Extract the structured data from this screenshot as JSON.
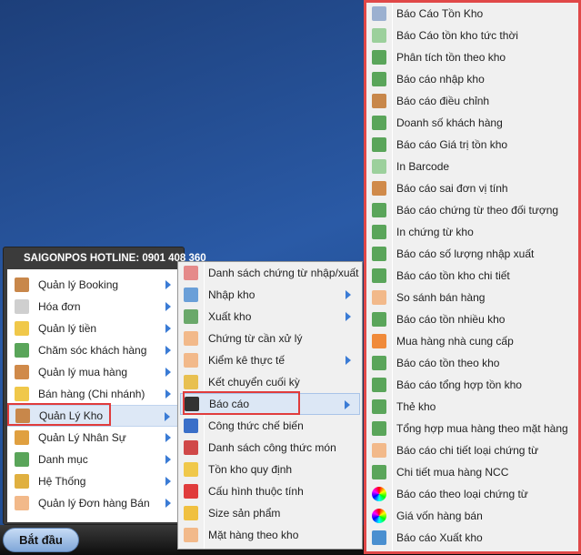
{
  "colors": {
    "highlight_box": "#e03c3c",
    "accent_arrow": "#3a7bd5"
  },
  "start_menu": {
    "hotline": "SAIGONPOS HOTLINE: 0901 408 360",
    "items": [
      {
        "label": "Quản lý Booking",
        "icon": "house-icon",
        "color": "#c8874a"
      },
      {
        "label": "Hóa đơn",
        "icon": "box-icon",
        "color": "#cfcfcf"
      },
      {
        "label": "Quản lý tiền",
        "icon": "folder-icon",
        "color": "#f0c84a"
      },
      {
        "label": "Chăm sóc khách hàng",
        "icon": "network-icon",
        "color": "#5aa55a"
      },
      {
        "label": "Quản lý mua hàng",
        "icon": "user-house-icon",
        "color": "#d08a4a"
      },
      {
        "label": "Bán hàng (Chi nhánh)",
        "icon": "folder-icon",
        "color": "#f0c84a"
      },
      {
        "label": "Quản Lý Kho",
        "icon": "house-icon",
        "color": "#c8874a",
        "selected": true
      },
      {
        "label": "Quản Lý Nhân Sự",
        "icon": "user-icon",
        "color": "#e0a040"
      },
      {
        "label": "Danh mục",
        "icon": "network-icon",
        "color": "#5aa55a"
      },
      {
        "label": "Hệ Thống",
        "icon": "system-icon",
        "color": "#e0b040"
      },
      {
        "label": "Quản lý Đơn hàng Bán",
        "icon": "tag-icon",
        "color": "#f2b98a"
      }
    ]
  },
  "kho_menu": {
    "items": [
      {
        "label": "Danh sách chứng từ nhập/xuất",
        "icon": "table-icon",
        "color": "#e58a8a",
        "arrow": false
      },
      {
        "label": "Nhập kho",
        "icon": "window-in-icon",
        "color": "#6a9fd8",
        "arrow": true
      },
      {
        "label": "Xuất kho",
        "icon": "window-out-icon",
        "color": "#6aa86a",
        "arrow": true
      },
      {
        "label": "Chứng từ cần xử lý",
        "icon": "tag-icon",
        "color": "#f2b98a",
        "arrow": false
      },
      {
        "label": "Kiểm kê thực tế",
        "icon": "tag-icon",
        "color": "#f2b98a",
        "arrow": true
      },
      {
        "label": "Kết chuyển cuối kỳ",
        "icon": "transfer-icon",
        "color": "#e8c050",
        "arrow": false
      },
      {
        "label": "Báo cáo",
        "icon": "magic-wand-icon",
        "color": "#333",
        "arrow": true,
        "selected": true
      },
      {
        "label": "Công thức chế biến",
        "icon": "ab-icon",
        "color": "#3a6fc8",
        "arrow": false
      },
      {
        "label": "Danh sách công thức món",
        "icon": "cubes-icon",
        "color": "#d04848",
        "arrow": false
      },
      {
        "label": "Tồn kho quy định",
        "icon": "folder-icon",
        "color": "#f0c84a",
        "arrow": false
      },
      {
        "label": "Cấu hình thuộc tính",
        "icon": "gem-icon",
        "color": "#e03c3c",
        "arrow": false
      },
      {
        "label": "Size sản phẩm",
        "icon": "cake-icon",
        "color": "#f0c040",
        "arrow": false
      },
      {
        "label": "Mặt hàng theo kho",
        "icon": "tag-icon",
        "color": "#f2b98a",
        "arrow": false
      }
    ]
  },
  "bao_cao_menu": {
    "items": [
      {
        "label": "Báo Cáo Tồn Kho",
        "icon": "report-icon",
        "color": "#9bb0d0"
      },
      {
        "label": "Báo Cáo tồn kho tức thời",
        "icon": "tag-icon",
        "color": "#9cd09c"
      },
      {
        "label": "Phân tích tồn theo kho",
        "icon": "report-export-icon",
        "color": "#5aa55a"
      },
      {
        "label": "Báo cáo nhập kho",
        "icon": "report-export-icon",
        "color": "#5aa55a"
      },
      {
        "label": "Báo cáo điều chỉnh",
        "icon": "houses-icon",
        "color": "#c8874a"
      },
      {
        "label": "Doanh số khách hàng",
        "icon": "report-export-icon",
        "color": "#5aa55a"
      },
      {
        "label": "Báo cáo Giá trị tồn kho",
        "icon": "report-export-icon",
        "color": "#5aa55a"
      },
      {
        "label": "In Barcode",
        "icon": "tag-icon",
        "color": "#9cd09c"
      },
      {
        "label": "Báo cáo sai đơn vị tính",
        "icon": "user-house-icon",
        "color": "#d08a4a"
      },
      {
        "label": "Báo cáo chứng từ theo đối tượng",
        "icon": "network-icon",
        "color": "#5aa55a"
      },
      {
        "label": "In chứng từ kho",
        "icon": "report-export-icon",
        "color": "#5aa55a"
      },
      {
        "label": "Báo cáo số lượng nhập xuất",
        "icon": "report-export-icon",
        "color": "#5aa55a"
      },
      {
        "label": "Báo cáo tồn kho chi tiết",
        "icon": "report-export-icon",
        "color": "#5aa55a"
      },
      {
        "label": "So sánh bán hàng",
        "icon": "tag-icon",
        "color": "#f2b98a"
      },
      {
        "label": "Báo cáo tồn nhiều kho",
        "icon": "report-export-icon",
        "color": "#5aa55a"
      },
      {
        "label": "Mua hàng nhà cung cấp",
        "icon": "rss-export-icon",
        "color": "#f08a3a"
      },
      {
        "label": "Báo cáo tồn theo kho",
        "icon": "report-export-icon",
        "color": "#5aa55a"
      },
      {
        "label": "Báo cáo tổng hợp tồn kho",
        "icon": "report-export-icon",
        "color": "#5aa55a"
      },
      {
        "label": "Thẻ kho",
        "icon": "report-export-icon",
        "color": "#5aa55a"
      },
      {
        "label": "Tổng hợp mua hàng theo mặt hàng",
        "icon": "report-export-icon",
        "color": "#5aa55a"
      },
      {
        "label": "Báo cáo chi tiết loại chứng từ",
        "icon": "tag-icon",
        "color": "#f2b98a"
      },
      {
        "label": "Chi tiết mua hàng NCC",
        "icon": "report-export-icon",
        "color": "#5aa55a"
      },
      {
        "label": "Báo cáo theo loại chứng từ",
        "icon": "color-wheel-icon",
        "color": "conic"
      },
      {
        "label": "Giá vốn hàng bán",
        "icon": "color-wheel-icon",
        "color": "conic"
      },
      {
        "label": "Báo cáo Xuất kho",
        "icon": "window-export-icon",
        "color": "#4a8fd0"
      }
    ]
  },
  "taskbar": {
    "start_label": "Bắt đầu"
  }
}
